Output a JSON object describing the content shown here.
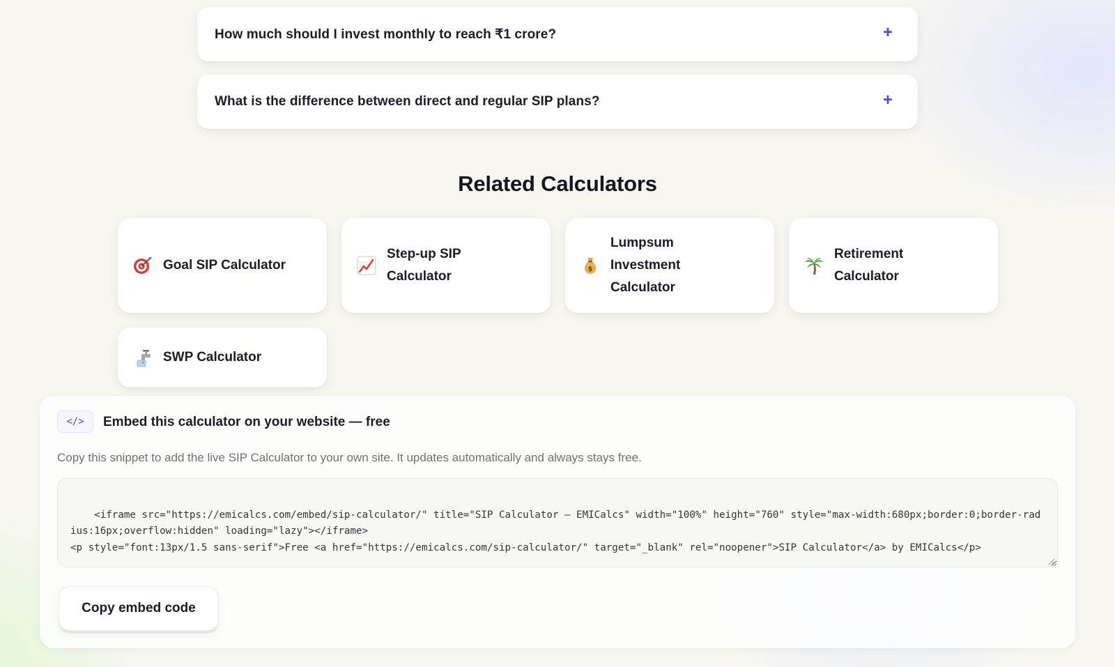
{
  "faq": [
    {
      "question": "How much should I invest monthly to reach ₹1 crore?",
      "toggle": "+"
    },
    {
      "question": "What is the difference between direct and regular SIP plans?",
      "toggle": "+"
    }
  ],
  "related": {
    "title": "Related Calculators",
    "items": [
      {
        "label": "Goal SIP Calculator",
        "icon": "target-icon"
      },
      {
        "label": "Step-up SIP Calculator",
        "icon": "chart-increasing-icon"
      },
      {
        "label": "Lumpsum Investment Calculator",
        "icon": "money-bag-icon"
      },
      {
        "label": "Retirement Calculator",
        "icon": "palm-tree-icon"
      },
      {
        "label": "SWP Calculator",
        "icon": "faucet-icon"
      }
    ]
  },
  "embed": {
    "badge": "</>",
    "title": "Embed this calculator on your website — free",
    "description": "Copy this snippet to add the live SIP Calculator to your own site. It updates automatically and always stays free.",
    "code": "<iframe src=\"https://emicalcs.com/embed/sip-calculator/\" title=\"SIP Calculator — EMICalcs\" width=\"100%\" height=\"760\" style=\"max-width:680px;border:0;border-radius:16px;overflow:hidden\" loading=\"lazy\"></iframe>\n<p style=\"font:13px/1.5 sans-serif\">Free <a href=\"https://emicalcs.com/sip-calculator/\" target=\"_blank\" rel=\"noopener\">SIP Calculator</a> by EMICalcs</p>",
    "copy_button": "Copy embed code"
  },
  "colors": {
    "accent": "#5a3df0",
    "background": "#f7f6f1",
    "card": "#ffffff",
    "text": "#1c1c28",
    "muted_text": "#6f6f78"
  }
}
